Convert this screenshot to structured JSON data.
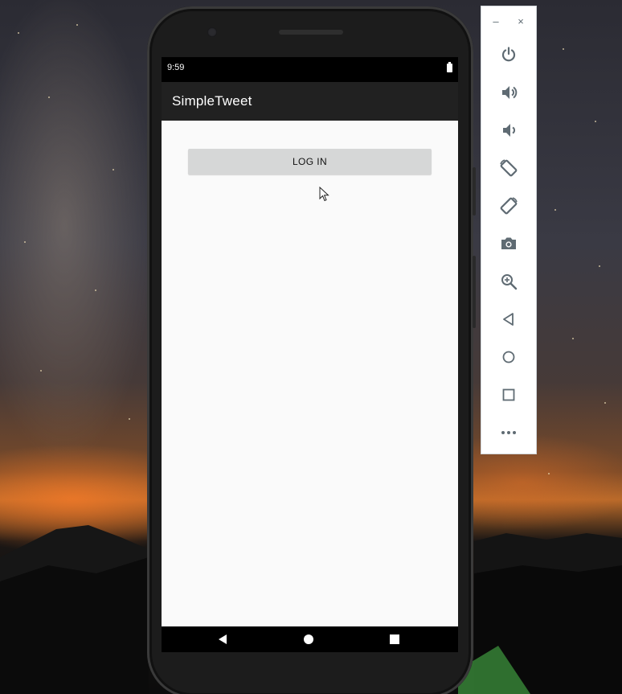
{
  "device": {
    "status_time": "9:59",
    "battery": "battery-full-icon"
  },
  "app": {
    "title": "SimpleTweet",
    "login_label": "LOG IN"
  },
  "navbar": {
    "buttons": [
      "back-icon",
      "home-icon",
      "recents-icon"
    ]
  },
  "emulator_toolbar": {
    "window_controls": [
      "minimize",
      "close"
    ],
    "minimize_glyph": "–",
    "close_glyph": "×",
    "tools": [
      "power-icon",
      "volume-up-icon",
      "volume-down-icon",
      "rotate-left-icon",
      "rotate-right-icon",
      "camera-icon",
      "zoom-icon",
      "back-icon",
      "home-icon",
      "overview-icon",
      "more-icon"
    ]
  },
  "colors": {
    "appbar": "#212121",
    "screen_bg": "#fafafa",
    "button_bg": "#d6d7d7",
    "toolbar_icon": "#5f6b73"
  }
}
